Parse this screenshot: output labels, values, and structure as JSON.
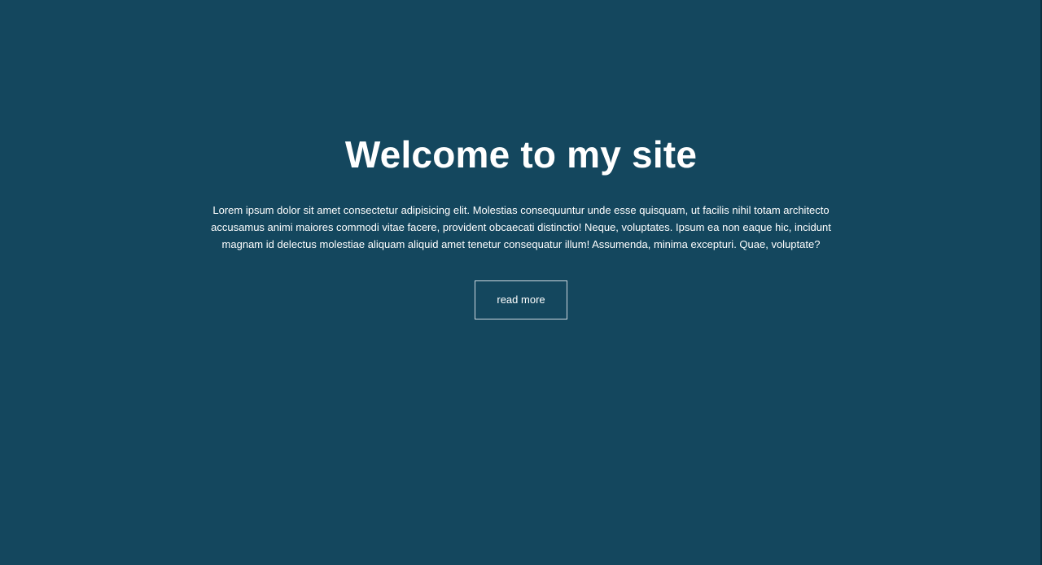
{
  "hero": {
    "title": "Welcome to my site",
    "paragraph": "Lorem ipsum dolor sit amet consectetur adipisicing elit. Molestias consequuntur unde esse quisquam, ut facilis nihil totam architecto accusamus animi maiores commodi vitae facere, provident obcaecati distinctio! Neque, voluptates. Ipsum ea non eaque hic, incidunt magnam id delectus molestiae aliquam aliquid amet tenetur consequatur illum! Assumenda, minima excepturi. Quae, voluptate?",
    "button_label": "read more"
  },
  "colors": {
    "background": "#14475e",
    "text": "#ffffff",
    "button_border": "#cfd9df"
  }
}
